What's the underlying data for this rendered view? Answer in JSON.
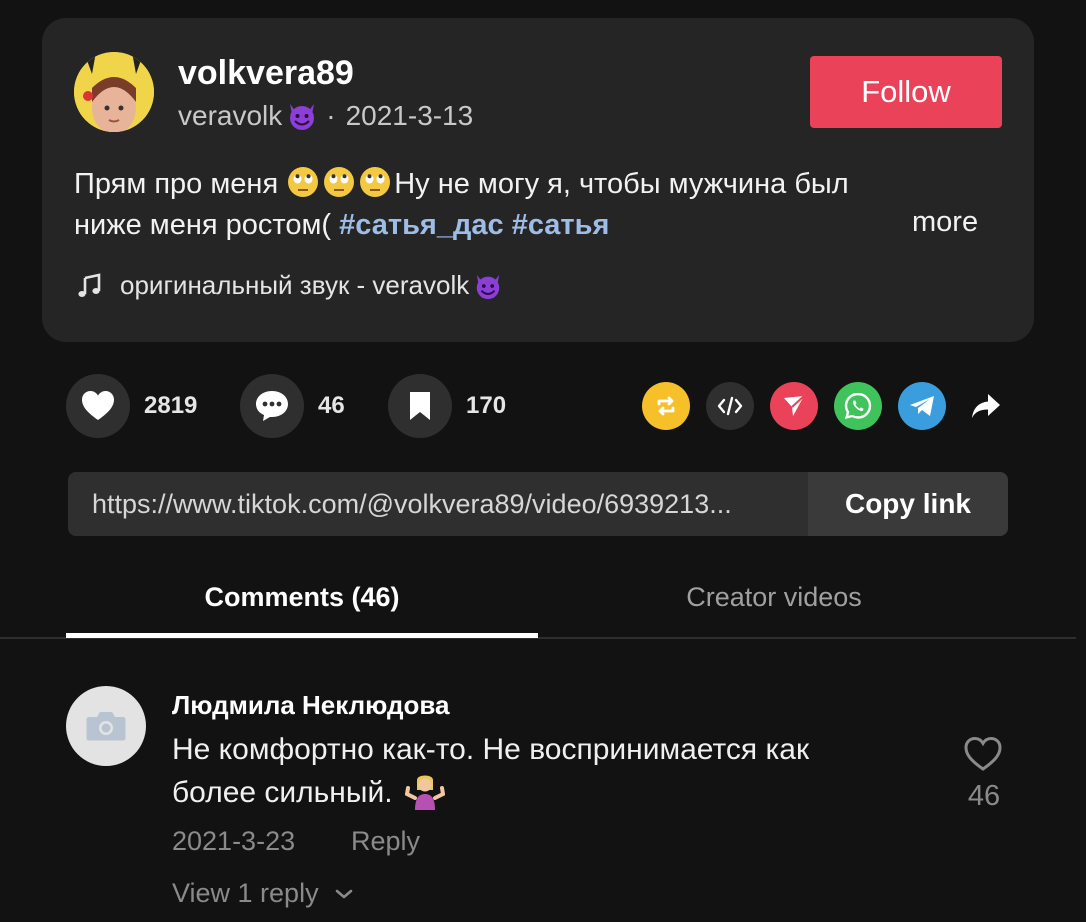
{
  "post": {
    "username": "volkvera89",
    "nickname": "veravolk",
    "date_sep": "·",
    "date": "2021-3-13",
    "follow_label": "Follow",
    "desc_text": "Прям про меня",
    "desc_text2": "Ну не могу я, чтобы мужчина был",
    "desc_line2": "ниже меня ростом(",
    "hashtags": [
      "#сатья_дас",
      "#сатья"
    ],
    "more_label": "more",
    "sound": "оригинальный звук - veravolk"
  },
  "actions": {
    "likes": "2819",
    "comments": "46",
    "saves": "170"
  },
  "share_icons": [
    "repost-icon",
    "embed-icon",
    "send-icon",
    "whatsapp-icon",
    "telegram-icon",
    "share-arrow-icon"
  ],
  "link": {
    "url": "https://www.tiktok.com/@volkvera89/video/6939213...",
    "copy_label": "Copy link"
  },
  "tabs": [
    {
      "label": "Comments (46)",
      "active": true
    },
    {
      "label": "Creator videos",
      "active": false
    }
  ],
  "comment": {
    "author": "Людмила Неклюдова",
    "text_line1": "Не комфортно как-то. Не воспринимается как",
    "text_line2": "более сильный.",
    "date": "2021-3-23",
    "reply_label": "Reply",
    "view_replies": "View 1 reply",
    "likes": "46"
  },
  "colors": {
    "follow": "#ea4359",
    "hashtag": "#9ebde6",
    "repost": "#f5c02a",
    "send": "#ea4359",
    "whatsapp": "#40c35a",
    "telegram": "#3a9ede"
  }
}
